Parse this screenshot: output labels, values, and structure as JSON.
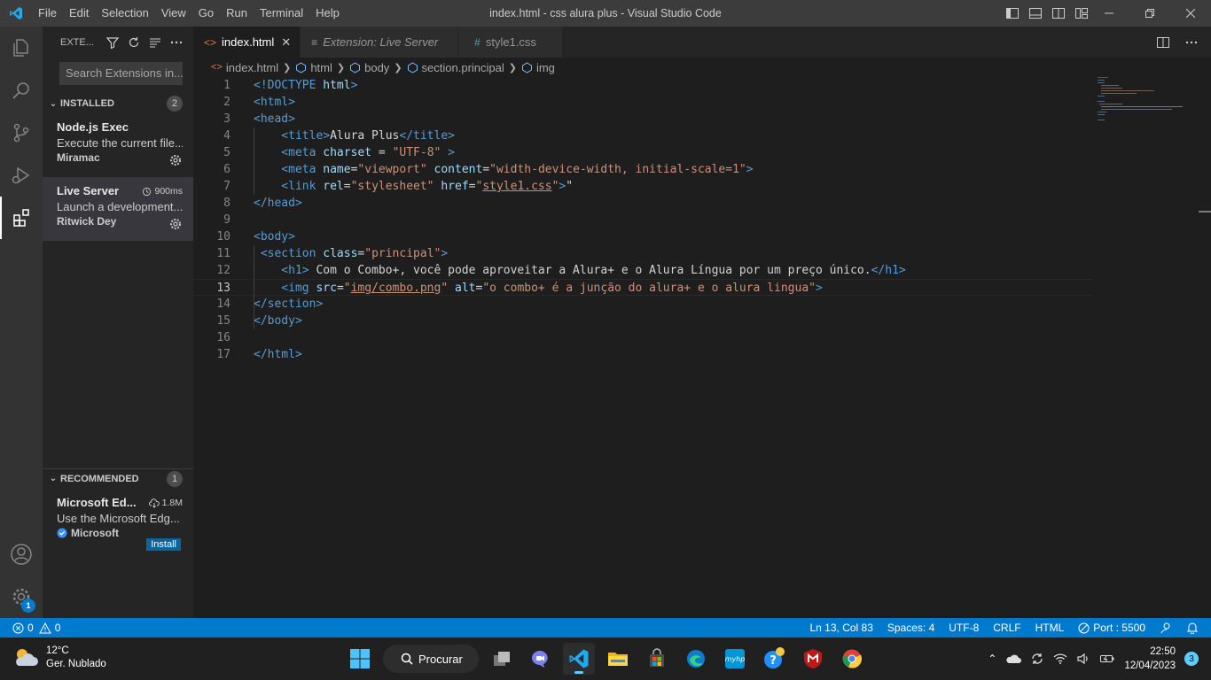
{
  "titlebar": {
    "menu": [
      "File",
      "Edit",
      "Selection",
      "View",
      "Go",
      "Run",
      "Terminal",
      "Help"
    ],
    "title": "index.html - css alura plus - Visual Studio Code"
  },
  "sidebar": {
    "header": "EXTE...",
    "search_placeholder": "Search Extensions in...",
    "installed": {
      "label": "INSTALLED",
      "count": "2",
      "items": [
        {
          "name": "Node.js Exec",
          "desc": "Execute the current file...",
          "publisher": "Miramac",
          "meta": ""
        },
        {
          "name": "Live Server",
          "desc": "Launch a development...",
          "publisher": "Ritwick Dey",
          "meta": "900ms"
        }
      ]
    },
    "recommended": {
      "label": "RECOMMENDED",
      "count": "1",
      "items": [
        {
          "name": "Microsoft Ed...",
          "desc": "Use the Microsoft Edg...",
          "publisher": "Microsoft",
          "meta": "1.8M",
          "install": "Install"
        }
      ]
    }
  },
  "activity": {
    "settings_badge": "1"
  },
  "tabs": [
    {
      "label": "index.html",
      "active": true
    },
    {
      "label": "Extension: Live Server",
      "active": false
    },
    {
      "label": "style1.css",
      "active": false
    }
  ],
  "breadcrumb": [
    "index.html",
    "html",
    "body",
    "section.principal",
    "img"
  ],
  "editor": {
    "current_line": 13,
    "line_numbers": [
      "1",
      "2",
      "3",
      "4",
      "5",
      "6",
      "7",
      "8",
      "9",
      "10",
      "11",
      "12",
      "13",
      "14",
      "15",
      "16",
      "17"
    ],
    "lines": [
      {
        "tokens": [
          [
            "<!DOCTYPE ",
            "t-doc"
          ],
          [
            "html",
            "t-attr"
          ],
          [
            ">",
            "t-doc"
          ]
        ]
      },
      {
        "tokens": [
          [
            "<html>",
            "t-tag"
          ]
        ]
      },
      {
        "tokens": [
          [
            "<head>",
            "t-tag"
          ]
        ]
      },
      {
        "tokens": [
          [
            "    <title>",
            "t-tag"
          ],
          [
            "Alura Plus",
            "t-txt"
          ],
          [
            "</title>",
            "t-tag"
          ]
        ]
      },
      {
        "tokens": [
          [
            "    <meta ",
            "t-tag"
          ],
          [
            "charset",
            "t-attr"
          ],
          [
            " = ",
            "t-txt"
          ],
          [
            "\"UTF-8\"",
            "t-str"
          ],
          [
            " >",
            "t-tag"
          ]
        ]
      },
      {
        "tokens": [
          [
            "    <meta ",
            "t-tag"
          ],
          [
            "name",
            "t-attr"
          ],
          [
            "=",
            "t-txt"
          ],
          [
            "\"viewport\"",
            "t-str"
          ],
          [
            " ",
            "t-txt"
          ],
          [
            "content",
            "t-attr"
          ],
          [
            "=",
            "t-txt"
          ],
          [
            "\"width-device-width, initial-scale=1\"",
            "t-str"
          ],
          [
            ">",
            "t-tag"
          ]
        ]
      },
      {
        "tokens": [
          [
            "    <link ",
            "t-tag"
          ],
          [
            "rel",
            "t-attr"
          ],
          [
            "=",
            "t-txt"
          ],
          [
            "\"stylesheet\"",
            "t-str"
          ],
          [
            " ",
            "t-txt"
          ],
          [
            "href",
            "t-attr"
          ],
          [
            "=",
            "t-txt"
          ],
          [
            "\"",
            "t-str"
          ],
          [
            "style1.css",
            "t-str u"
          ],
          [
            "\"",
            "t-str"
          ],
          [
            ">",
            "t-tag"
          ],
          [
            "\"",
            "t-txt"
          ]
        ]
      },
      {
        "tokens": [
          [
            "</head>",
            "t-tag"
          ]
        ]
      },
      {
        "tokens": []
      },
      {
        "tokens": [
          [
            "<body>",
            "t-tag"
          ]
        ]
      },
      {
        "tokens": [
          [
            " <section ",
            "t-tag"
          ],
          [
            "class",
            "t-attr"
          ],
          [
            "=",
            "t-txt"
          ],
          [
            "\"principal\"",
            "t-str"
          ],
          [
            ">",
            "t-tag"
          ]
        ]
      },
      {
        "tokens": [
          [
            "    <h1>",
            "t-tag"
          ],
          [
            " Com o Combo+, você pode aproveitar a Alura+ e o Alura Língua por um preço único.",
            "t-txt"
          ],
          [
            "</h1>",
            "t-tag"
          ]
        ]
      },
      {
        "tokens": [
          [
            "    <img ",
            "t-tag"
          ],
          [
            "src",
            "t-attr"
          ],
          [
            "=",
            "t-txt"
          ],
          [
            "\"",
            "t-str"
          ],
          [
            "img/combo.png",
            "t-str u"
          ],
          [
            "\"",
            "t-str"
          ],
          [
            " ",
            "t-txt"
          ],
          [
            "alt",
            "t-attr"
          ],
          [
            "=",
            "t-txt"
          ],
          [
            "\"o combo+ é a junção do alura+ e o alura lingua\"",
            "t-str"
          ],
          [
            ">",
            "t-tag"
          ]
        ]
      },
      {
        "tokens": [
          [
            "</section>",
            "t-tag"
          ]
        ]
      },
      {
        "tokens": [
          [
            "</body>",
            "t-tag"
          ]
        ]
      },
      {
        "tokens": []
      },
      {
        "tokens": [
          [
            "</html>",
            "t-tag"
          ]
        ]
      }
    ]
  },
  "statusbar": {
    "errors": "0",
    "warnings": "0",
    "position": "Ln 13, Col 83",
    "spaces": "Spaces: 4",
    "encoding": "UTF-8",
    "eol": "CRLF",
    "language": "HTML",
    "port": "Port : 5500"
  },
  "taskbar": {
    "temp": "12°C",
    "weather": "Ger. Nublado",
    "search": "Procurar",
    "time": "22:50",
    "date": "12/04/2023",
    "notifications": "3"
  },
  "colors": {
    "accent": "#007acc",
    "tag": "#569cd6",
    "attr": "#9cdcfe",
    "string": "#ce9178",
    "text": "#d4d4d4"
  }
}
